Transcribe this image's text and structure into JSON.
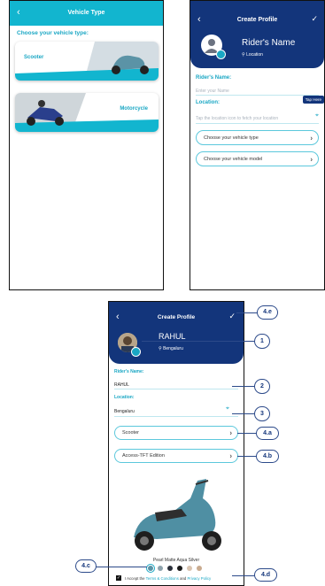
{
  "screen_a": {
    "title": "Vehicle Type",
    "prompt": "Choose your vehicle type:",
    "options": [
      "Scooter",
      "Motorcycle"
    ]
  },
  "screen_b": {
    "title": "Create Profile",
    "rider_name": "Rider's Name",
    "location_label_small": "Location",
    "name_label": "Rider's Name:",
    "name_placeholder": "Enter your Name",
    "location_label": "Location:",
    "location_placeholder": "Tap the location icon to fetch your location",
    "tooltip": "Tap Here",
    "vehicle_type_select": "Choose your vehicle type",
    "vehicle_model_select": "Choose your vehicle model"
  },
  "screen_c": {
    "title": "Create Profile",
    "rider_name": "RAHUL",
    "city": "Bengaluru",
    "name_label": "Rider's Name:",
    "name_value": "RAHUL",
    "location_label": "Location:",
    "location_value": "Bengaluru",
    "vehicle_type": "Scooter",
    "vehicle_model": "Access-TFT Edition",
    "color_name": "Pearl Matte Aqua Silver",
    "accept_prefix": "I Accept the",
    "terms_link": "Terms & Conditions",
    "and": "and",
    "privacy_link": "Privacy Policy"
  },
  "callouts": [
    "1",
    "2",
    "3",
    "4.a",
    "4.b",
    "4.c",
    "4.d",
    "4.e"
  ],
  "colors": {
    "teal": "#12b5cf",
    "navy": "#13357b",
    "accent": "#1aa7c4",
    "swatches": [
      "#5b93a6",
      "#8ea3ad",
      "#2a2f3a",
      "#1a1a1a",
      "#d9c4b0",
      "#c9ab8f"
    ]
  }
}
